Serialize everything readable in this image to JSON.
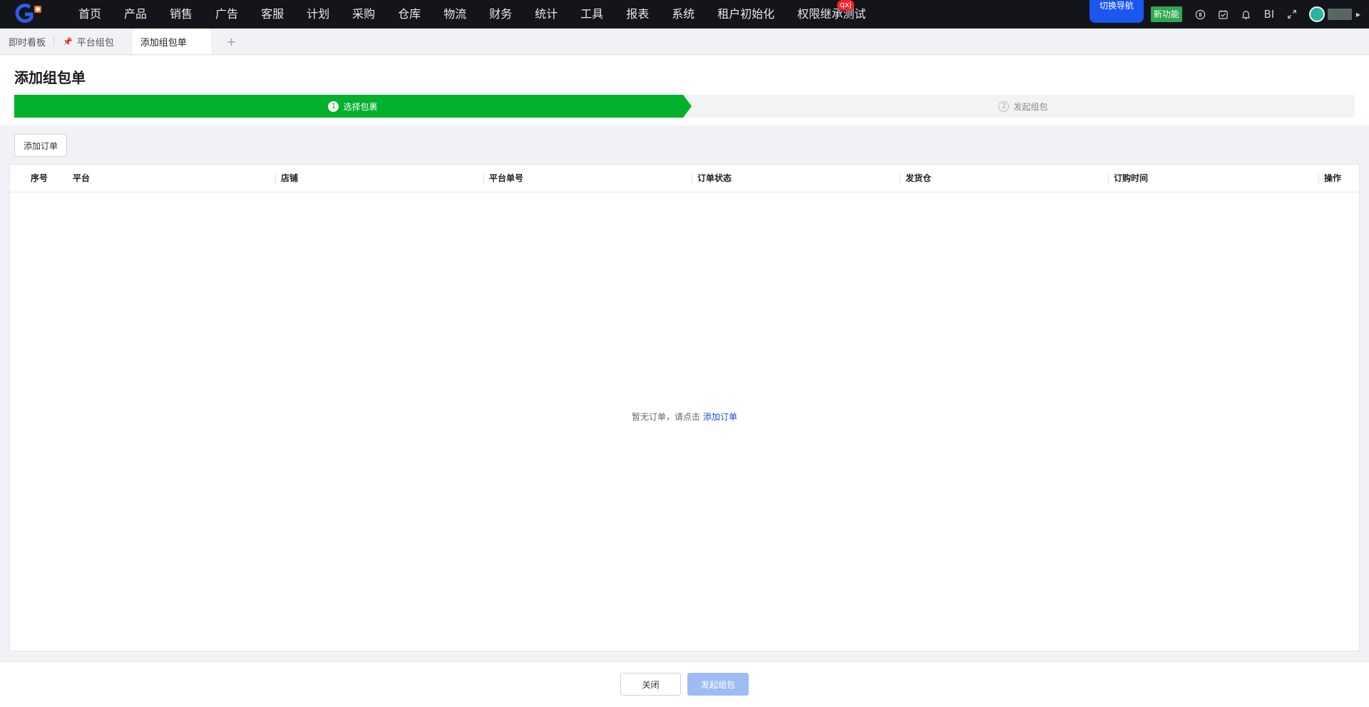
{
  "nav": {
    "items": [
      "首页",
      "产品",
      "销售",
      "广告",
      "客服",
      "计划",
      "采购",
      "仓库",
      "物流",
      "财务",
      "统计",
      "工具",
      "报表",
      "系统",
      "租户初始化",
      "权限继承测试"
    ],
    "badge": "qxj",
    "switch_nav": "切换导航",
    "new_feature": "新功能",
    "bi_label": "BI"
  },
  "tabs": {
    "items": [
      "即时看板",
      "平台组包",
      "添加组包单"
    ],
    "add_symbol": "+"
  },
  "page": {
    "title": "添加组包单"
  },
  "steps": [
    {
      "num": "1",
      "label": "选择包裹",
      "status": "active"
    },
    {
      "num": "2",
      "label": "发起组包",
      "status": "pending"
    }
  ],
  "toolbar": {
    "add_order": "添加订单"
  },
  "table": {
    "columns": [
      "序号",
      "平台",
      "店铺",
      "平台单号",
      "订单状态",
      "发货仓",
      "订购时间",
      "操作"
    ],
    "rows": [],
    "empty_text": "暂无订单，请点击",
    "empty_link": "添加订单"
  },
  "footer": {
    "close": "关闭",
    "submit": "发起组包"
  },
  "colors": {
    "step_active": "#02b12c",
    "primary": "#1a56f0",
    "new_feature": "#2fa84f",
    "badge": "#f5222d"
  }
}
